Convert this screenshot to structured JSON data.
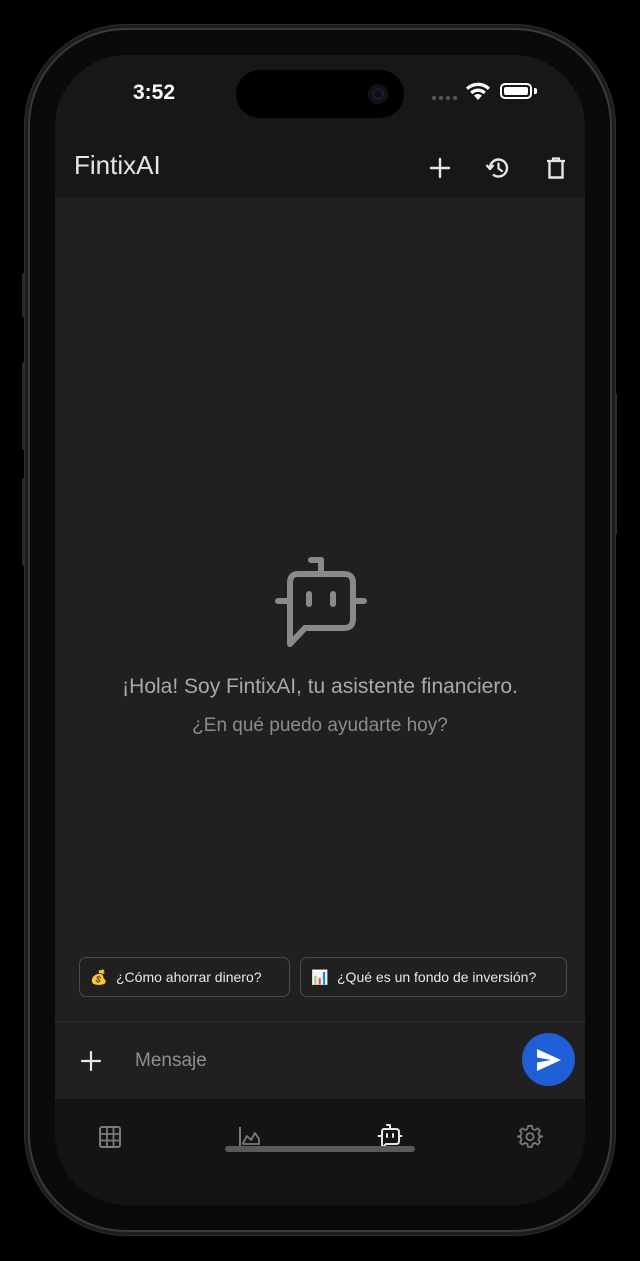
{
  "status": {
    "time": "3:52"
  },
  "appbar": {
    "title": "FintixAI"
  },
  "icons": {
    "new_chat": "plus-icon",
    "history": "history-icon",
    "delete": "trash-icon",
    "bot": "robot-chat-icon",
    "send": "send-icon"
  },
  "empty_state": {
    "greeting": "¡Hola! Soy FintixAI, tu asistente financiero.",
    "subtitle": "¿En qué puedo ayudarte hoy?"
  },
  "suggestions": [
    {
      "emoji": "💰",
      "label": "¿Cómo ahorrar dinero?"
    },
    {
      "emoji": "📊",
      "label": "¿Qué es un fondo de inversión?"
    }
  ],
  "composer": {
    "placeholder": "Mensaje"
  },
  "bottom_nav": [
    {
      "icon": "table-icon",
      "active": false
    },
    {
      "icon": "chart-icon",
      "active": false
    },
    {
      "icon": "assistant-icon",
      "active": true
    },
    {
      "icon": "settings-icon",
      "active": false
    }
  ],
  "colors": {
    "accent": "#1e5ed6",
    "background": "#202020",
    "bar": "#17171a"
  }
}
